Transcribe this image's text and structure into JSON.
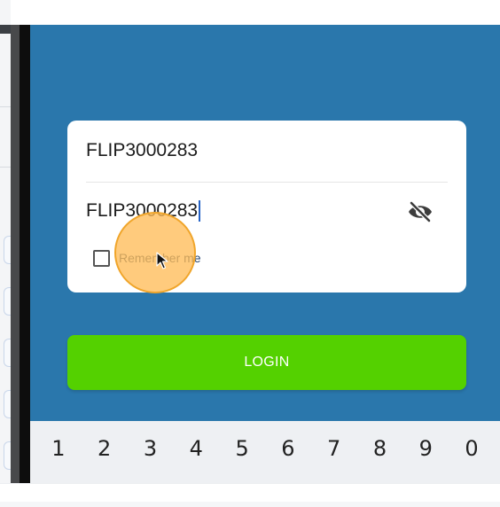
{
  "login_form": {
    "username_value": "FLIP3000283",
    "password_value": "FLIP3000283",
    "password_visibility_icon": "eye-off-icon",
    "remember_me_label": "Remember me",
    "remember_me_checked": false,
    "login_label": "LOGIN"
  },
  "keyboard": {
    "number_keys": [
      "1",
      "2",
      "3",
      "4",
      "5",
      "6",
      "7",
      "8",
      "9",
      "0"
    ]
  },
  "colors": {
    "screen_background": "#2a77ac",
    "login_button": "#54d100",
    "tap_indicator": "#ffbd59",
    "card_background": "#ffffff"
  }
}
